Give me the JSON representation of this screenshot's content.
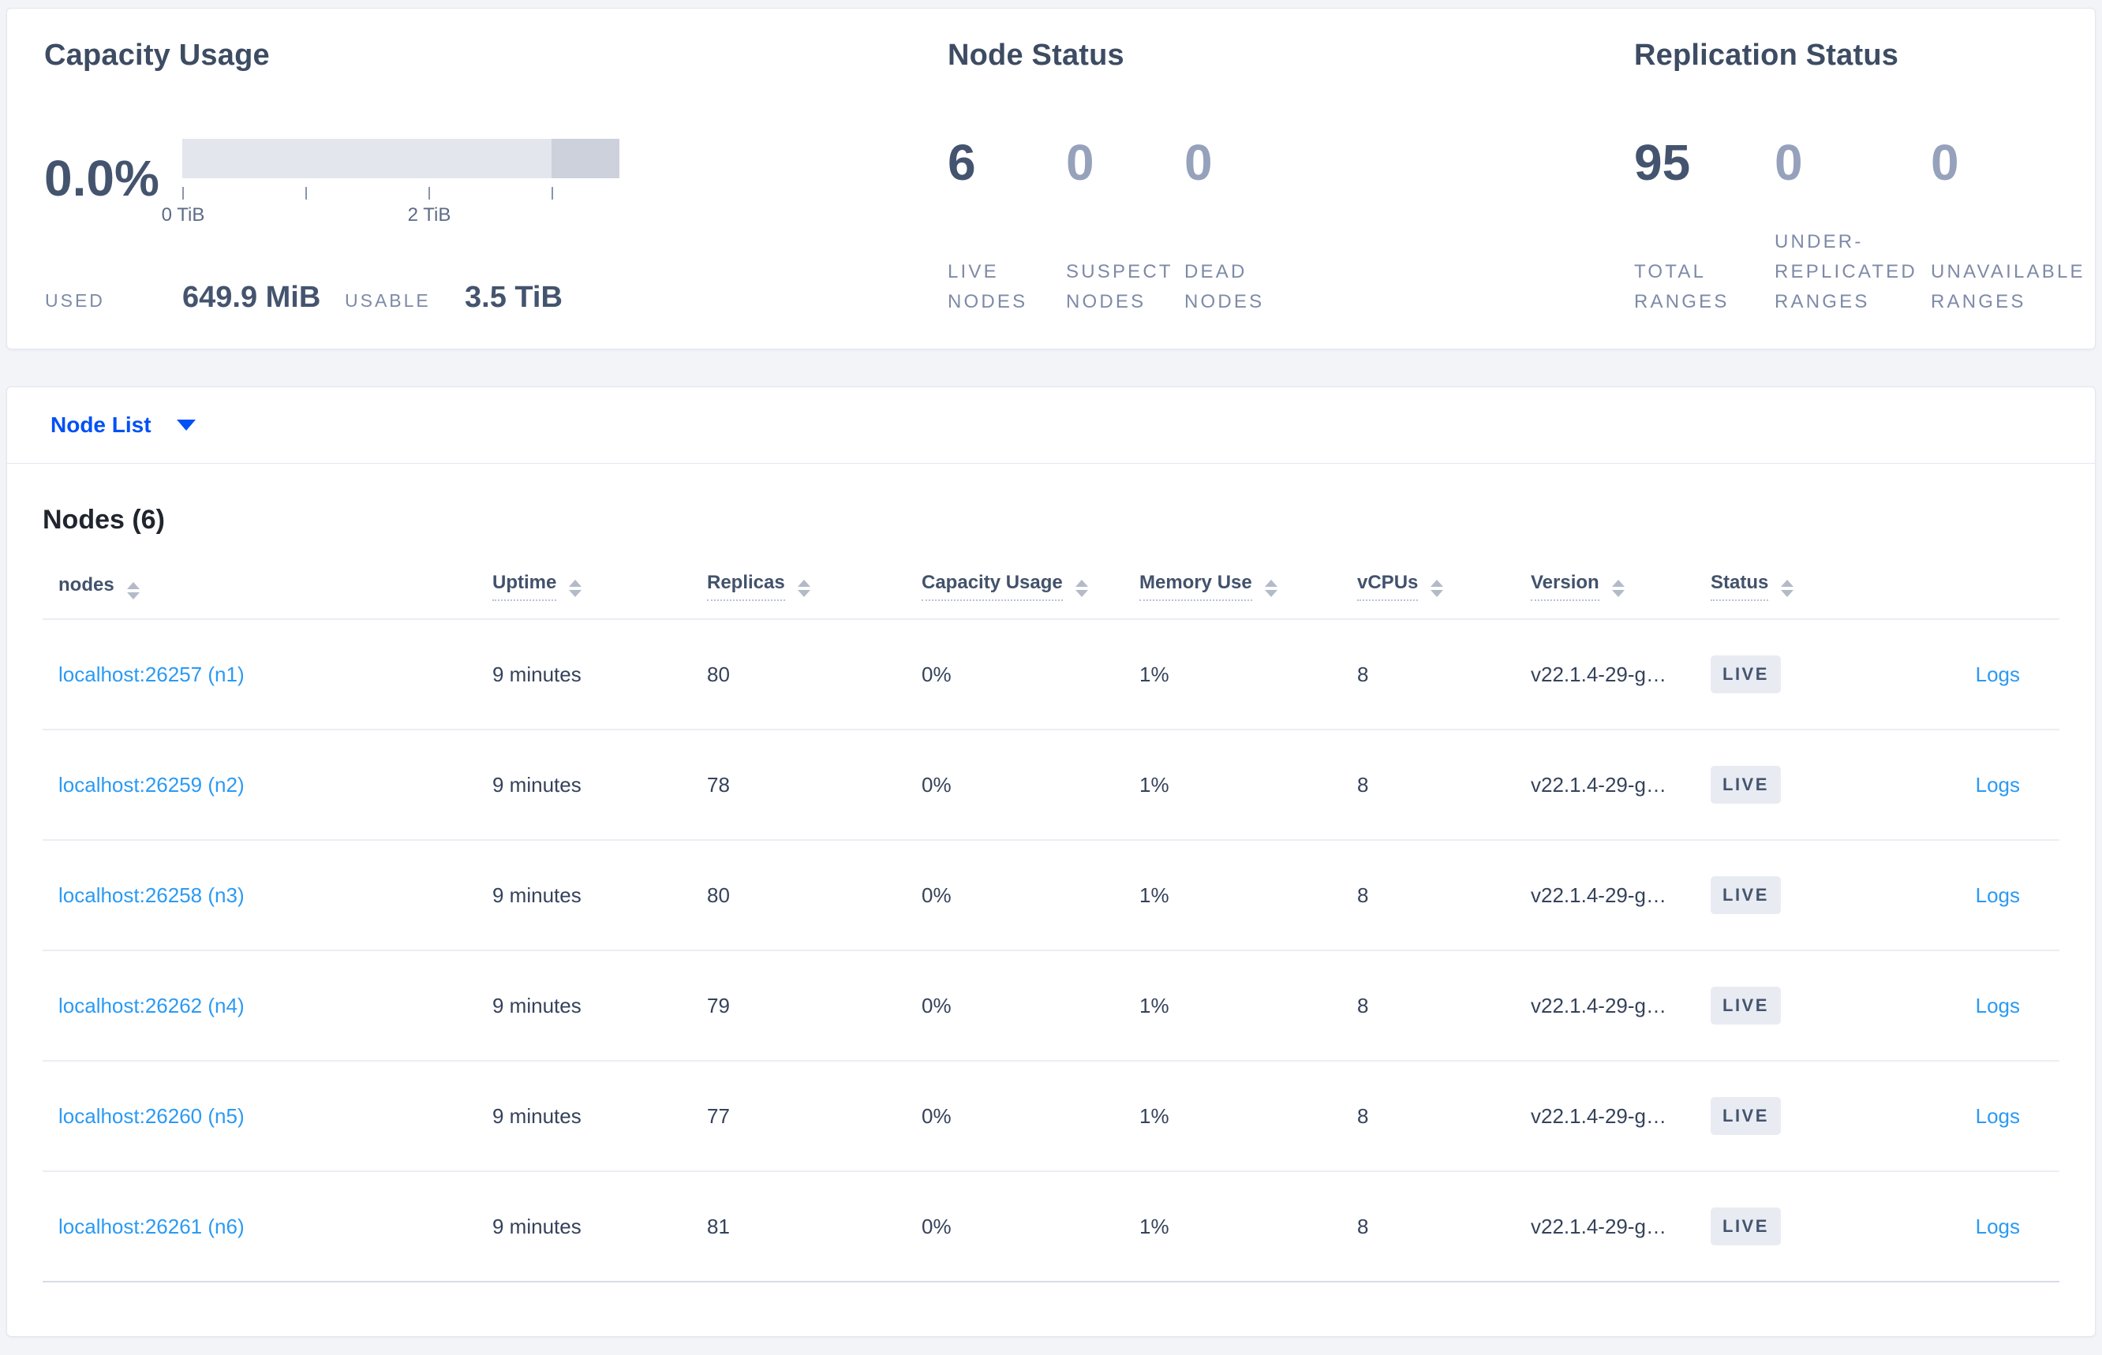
{
  "summary": {
    "capacity": {
      "title": "Capacity Usage",
      "percent": "0.0%",
      "ticks": [
        "0 TiB",
        "2 TiB"
      ],
      "used_label": "USED",
      "used_value": "649.9 MiB",
      "usable_label": "USABLE",
      "usable_value": "3.5 TiB"
    },
    "node_status": {
      "title": "Node Status",
      "metrics": [
        {
          "value": "6",
          "label": "LIVE NODES"
        },
        {
          "value": "0",
          "label": "SUSPECT NODES"
        },
        {
          "value": "0",
          "label": "DEAD NODES"
        }
      ]
    },
    "replication": {
      "title": "Replication Status",
      "metrics": [
        {
          "value": "95",
          "label": "TOTAL RANGES"
        },
        {
          "value": "0",
          "label": "UNDER-REPLICATED RANGES"
        },
        {
          "value": "0",
          "label": "UNAVAILABLE RANGES"
        }
      ]
    }
  },
  "view_selector": {
    "label": "Node List",
    "icon": "caret-down-icon"
  },
  "nodes_panel": {
    "title": "Nodes (6)",
    "columns": [
      {
        "label": "nodes"
      },
      {
        "label": "Uptime"
      },
      {
        "label": "Replicas"
      },
      {
        "label": "Capacity Usage"
      },
      {
        "label": "Memory Use"
      },
      {
        "label": "vCPUs"
      },
      {
        "label": "Version"
      },
      {
        "label": "Status"
      }
    ],
    "rows": [
      {
        "node": "localhost:26257 (n1)",
        "uptime": "9 minutes",
        "replicas": "80",
        "capacity": "0%",
        "memory": "1%",
        "vcpus": "8",
        "version": "v22.1.4-29-g…",
        "status": "LIVE",
        "logs": "Logs"
      },
      {
        "node": "localhost:26259 (n2)",
        "uptime": "9 minutes",
        "replicas": "78",
        "capacity": "0%",
        "memory": "1%",
        "vcpus": "8",
        "version": "v22.1.4-29-g…",
        "status": "LIVE",
        "logs": "Logs"
      },
      {
        "node": "localhost:26258 (n3)",
        "uptime": "9 minutes",
        "replicas": "80",
        "capacity": "0%",
        "memory": "1%",
        "vcpus": "8",
        "version": "v22.1.4-29-g…",
        "status": "LIVE",
        "logs": "Logs"
      },
      {
        "node": "localhost:26262 (n4)",
        "uptime": "9 minutes",
        "replicas": "79",
        "capacity": "0%",
        "memory": "1%",
        "vcpus": "8",
        "version": "v22.1.4-29-g…",
        "status": "LIVE",
        "logs": "Logs"
      },
      {
        "node": "localhost:26260 (n5)",
        "uptime": "9 minutes",
        "replicas": "77",
        "capacity": "0%",
        "memory": "1%",
        "vcpus": "8",
        "version": "v22.1.4-29-g…",
        "status": "LIVE",
        "logs": "Logs"
      },
      {
        "node": "localhost:26261 (n6)",
        "uptime": "9 minutes",
        "replicas": "81",
        "capacity": "0%",
        "memory": "1%",
        "vcpus": "8",
        "version": "v22.1.4-29-g…",
        "status": "LIVE",
        "logs": "Logs"
      }
    ]
  },
  "chart_data": {
    "type": "bar",
    "title": "Capacity Usage",
    "used_percent": 0.0,
    "used": "649.9 MiB",
    "usable": "3.5 TiB",
    "axis_ticks_tib": [
      0,
      1,
      2,
      3
    ],
    "axis_labeled_ticks": [
      "0 TiB",
      "2 TiB"
    ],
    "bar_total_tib": 3.55,
    "bar_light_segment_tib": [
      0,
      3.0
    ],
    "bar_dark_segment_tib": [
      3.0,
      3.55
    ]
  },
  "colors": {
    "page_background": "#f2f4f8",
    "card_background": "#ffffff",
    "card_border": "#e3e6ed",
    "heading_text": "#3d4c63",
    "metric_emphasis": "#44546e",
    "metric_muted": "#96a1bc",
    "caps_label": "#7e8aa7",
    "bar_light": "#e3e6ed",
    "bar_dark": "#cdd1dc",
    "dropdown_blue": "#0050f5",
    "link_blue": "#2b9af3",
    "badge_background": "#e8ebf2",
    "badge_text": "#44546e"
  }
}
